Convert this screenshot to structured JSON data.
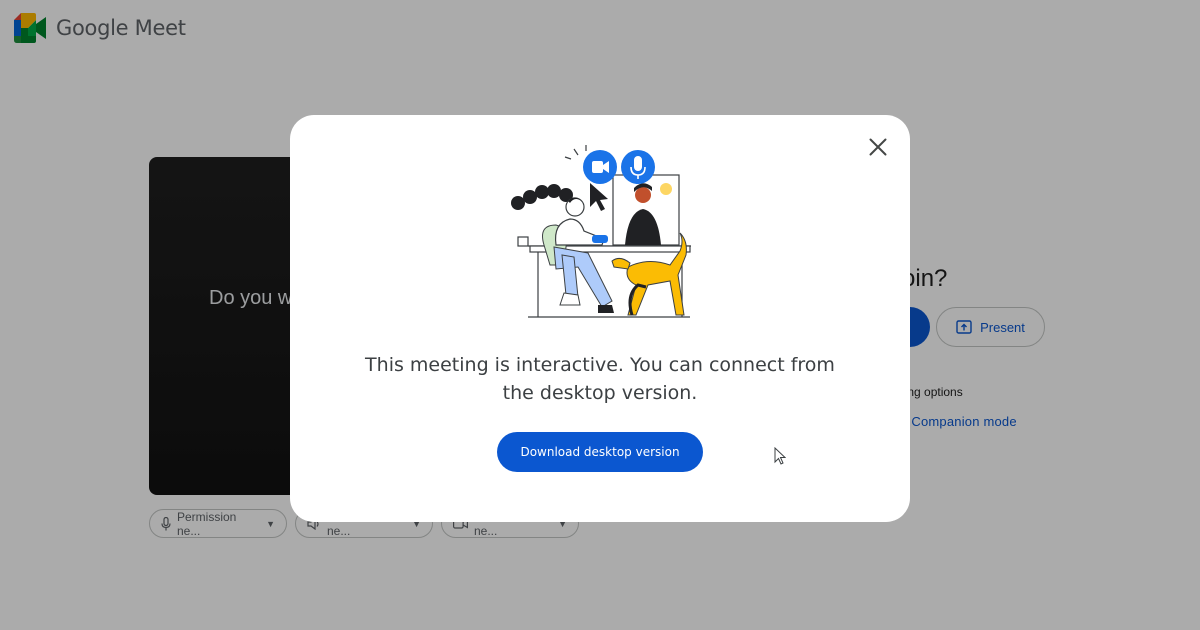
{
  "app": {
    "title": "Google Meet",
    "logo_icon": "google-meet-logo-icon"
  },
  "preview": {
    "prompt": "Do you w"
  },
  "permission_pills": [
    {
      "label": "Permission ne...",
      "icon": "microphone-icon"
    },
    {
      "label": "Permission ne...",
      "icon": "speaker-icon"
    },
    {
      "label": "Permission ne...",
      "icon": "camera-icon"
    }
  ],
  "join_panel": {
    "title": "dy to join?",
    "present_label": "Present",
    "other_options": "er joining options",
    "companion_link": "use Companion mode"
  },
  "dialog": {
    "message": "This meeting is interactive. You can connect from the desktop version.",
    "download_label": "Download desktop version",
    "close_icon": "close-icon",
    "illustration": "people-video-call-illustration"
  },
  "colors": {
    "primary": "#0b57d0",
    "scrim": "rgba(0,0,0,0.33)",
    "meet_green": "#00832d",
    "meet_blue": "#0066da",
    "meet_yellow": "#ffba00",
    "meet_red": "#e94235",
    "illustration_blue": "#1a73e8"
  }
}
